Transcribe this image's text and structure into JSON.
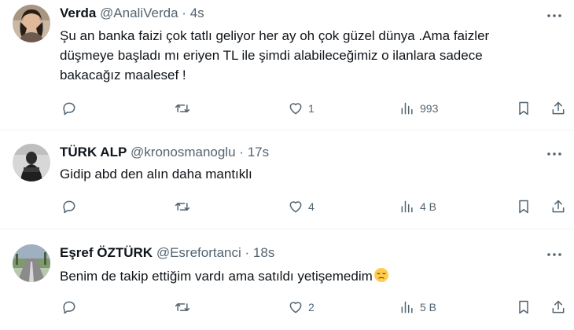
{
  "tweets": [
    {
      "name": "Verda",
      "handle": "@AnaliVerda",
      "separator": "·",
      "time": "4s",
      "text": "Şu an banka faizi çok tatlı geliyor her ay oh çok güzel dünya .Ama faizler düşmeye başladı mı eriyen TL ile şimdi alabileceğimiz  o ilanlara sadece bakacağız maalesef !",
      "reply_count": "",
      "retweet_count": "",
      "like_count": "1",
      "view_count": "993",
      "avatar_icon": "avatar-woman-photo"
    },
    {
      "name": "TÜRK ALP",
      "handle": "@kronosmanoglu",
      "separator": "·",
      "time": "17s",
      "text": "Gidip abd den alın daha mantıklı",
      "reply_count": "",
      "retweet_count": "",
      "like_count": "4",
      "view_count": "4 B",
      "avatar_icon": "avatar-dark-photo"
    },
    {
      "name": "Eşref ÖZTÜRK",
      "handle": "@Esrefortanci",
      "separator": "·",
      "time": "18s",
      "text": "Benim de takip ettiğim vardı ama satıldı yetişemedim",
      "emoji": "pensive-face-emoji",
      "reply_count": "",
      "retweet_count": "",
      "like_count": "2",
      "view_count": "5 B",
      "avatar_icon": "avatar-road-photo"
    }
  ],
  "colors": {
    "text": "#0f1419",
    "secondary": "#536471",
    "divider": "#eff3f4",
    "background": "#ffffff"
  }
}
